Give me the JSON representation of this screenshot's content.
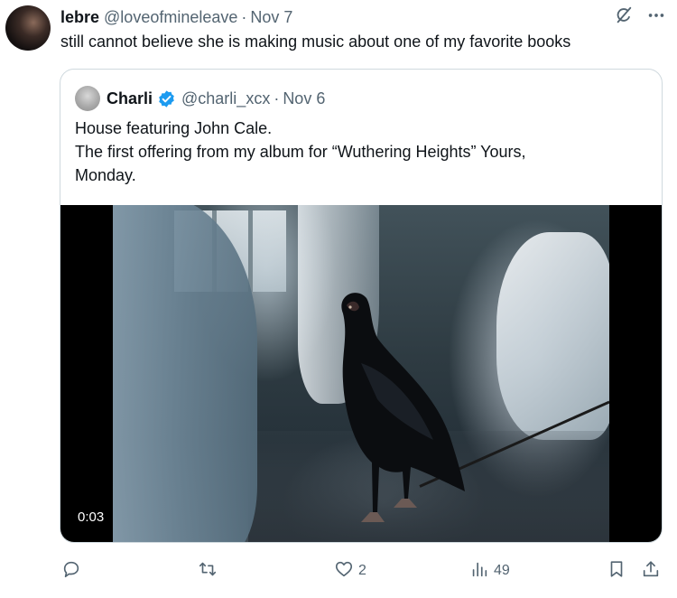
{
  "tweet": {
    "author_name": "lebre",
    "author_handle": "@loveofmineleave",
    "separator": "·",
    "date": "Nov 7",
    "text": "still cannot believe she is making music about one of my favorite books"
  },
  "quoted_tweet": {
    "author_name": "Charli",
    "author_handle": "@charli_xcx",
    "separator": "·",
    "date": "Nov 6",
    "text_lines": [
      "House featuring John Cale.",
      "The first offering from my album for “Wuthering Heights” Yours,",
      "Monday."
    ],
    "video_time": "0:03"
  },
  "actions": {
    "reply_count": "",
    "repost_count": "",
    "like_count": "2",
    "views_count": "49"
  },
  "icons": {
    "grok": "grok-icon",
    "more": "more-icon",
    "verified": "verified-badge-icon",
    "reply": "reply-icon",
    "repost": "repost-icon",
    "like": "heart-icon",
    "views": "views-icon",
    "bookmark": "bookmark-icon",
    "share": "share-icon"
  },
  "colors": {
    "text": "#0f1419",
    "muted": "#536471",
    "verified": "#1d9bf0",
    "border": "#cfd9de"
  }
}
